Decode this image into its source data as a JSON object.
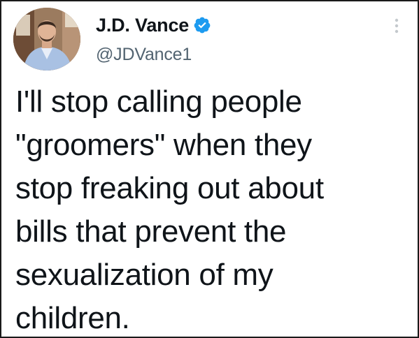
{
  "tweet": {
    "author": {
      "display_name": "J.D. Vance",
      "handle": "@JDVance1",
      "verified": true,
      "avatar_icon": "profile-photo"
    },
    "more_icon": "more-options-icon",
    "verified_icon": "verified-badge-icon",
    "text": "I'll stop calling people\n\"groomers\" when they\nstop freaking out about\nbills that prevent the\nsexualization of my\nchildren."
  },
  "colors": {
    "text_primary": "#0f1419",
    "text_secondary": "#536471",
    "verified_blue": "#1d9bf0",
    "border": "#1a1a1a",
    "background": "#ffffff"
  }
}
